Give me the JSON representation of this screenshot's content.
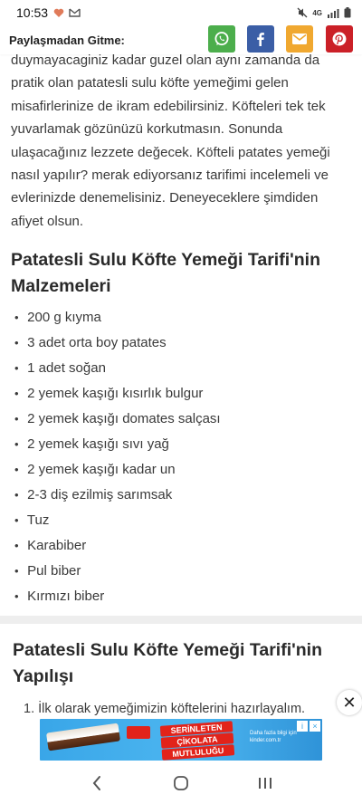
{
  "status": {
    "time": "10:53",
    "network": "4G"
  },
  "share": {
    "label": "Paylaşmadan Gitme:",
    "buttons": [
      {
        "name": "whatsapp",
        "color": "#4cae4c"
      },
      {
        "name": "facebook",
        "color": "#3b5ea6"
      },
      {
        "name": "mail",
        "color": "#f0a830"
      },
      {
        "name": "pinterest",
        "color": "#cb2027"
      }
    ]
  },
  "article": {
    "intro_lines": [
      "duymayacaginiz kadar guzel olan aynı zamanda da",
      "pratik olan patatesli sulu köfte yemeğimi gelen",
      "misafirlerinize de ikram edebilirsiniz. Köfteleri tek tek",
      "yuvarlamak gözünüzü korkutmasın. Sonunda",
      "ulaşacağınız lezzete değecek. Köfteli patates yemeği",
      "nasıl yapılır? merak ediyorsanız tarifimi incelemeli ve",
      "evlerinizde denemelisiniz. Deneyeceklere şimdiden",
      "afiyet olsun."
    ],
    "ingredients_heading": "Patatesli Sulu Köfte Yemeği Tarifi'nin Malzemeleri",
    "ingredients": [
      "200 g kıyma",
      "3 adet orta boy patates",
      "1 adet soğan",
      "2 yemek kaşığı kısırlık bulgur",
      "2 yemek kaşığı domates salçası",
      "2 yemek kaşığı sıvı yağ",
      "2 yemek kaşığı kadar un",
      "2-3 diş ezilmiş sarımsak",
      "Tuz",
      "Karabiber",
      "Pul biber",
      "Kırmızı biber"
    ],
    "bullet": "•",
    "method_heading": "Patatesli Sulu Köfte Yemeği Tarifi'nin Yapılışı",
    "steps": [
      "1.  İlk olarak yemeğimizin köftelerini hazırlayalım."
    ]
  },
  "ad": {
    "text_lines": [
      "SERİNLETEN",
      "ÇİKOLATA",
      "MUTLULUĞU"
    ],
    "small_text": "Daha fazla bilgi için kinder.com.tr",
    "close_label": "✕"
  },
  "colors": {
    "accent_whatsapp": "#4cae4c",
    "accent_facebook": "#3b5ea6",
    "accent_mail": "#f0a830",
    "accent_pinterest": "#cb2027"
  }
}
